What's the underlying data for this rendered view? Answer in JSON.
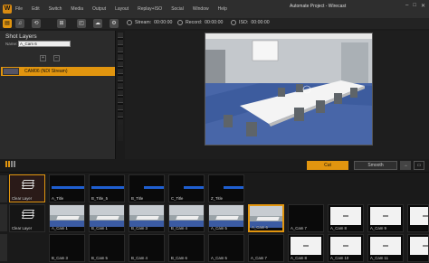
{
  "menubar": {
    "app_icon": "wirecast-logo",
    "items": [
      "File",
      "Edit",
      "Switch",
      "Media",
      "Output",
      "Layout",
      "Replay+ISO",
      "Social",
      "Window",
      "Help"
    ],
    "title": "Automate Project - Wirecast",
    "window_buttons": [
      "minimize",
      "maximize",
      "close"
    ]
  },
  "toolbar": {
    "icons": [
      "layers-icon",
      "audio-mixer-icon",
      "replay-icon",
      "transitions-icon",
      "add-icon",
      "cloud-icon",
      "tools-icon"
    ]
  },
  "status": {
    "stream_label": "Stream:",
    "stream_time": "00:00:00",
    "record_label": "Record:",
    "record_time": "00:00:00",
    "iso_label": "ISO:",
    "iso_time": "00:00:00"
  },
  "shot_layers": {
    "title": "Shot Layers",
    "name_label": "Name:",
    "name_value": "A_Cam 6",
    "add_label": "+",
    "remove_label": "−",
    "layer_name": "CAM06 (NDI Stream)"
  },
  "transition": {
    "cut_label": "Cut",
    "smooth_label": "Smooth",
    "go_label": "→"
  },
  "shots": {
    "row1": [
      "Clear Layer",
      "A_Title",
      "B_Title_5",
      "B_Title",
      "C_Title",
      "Z_Title"
    ],
    "row2": [
      "Clear Layer",
      "A_Cam 1",
      "B_Cam 1",
      "B_Cam 3",
      "B_Cam 4",
      "A_Cam 5",
      "A_Cam 6",
      "A_Cam 7",
      "A_Cam 8",
      "A_Cam 9"
    ],
    "row3": [
      "B_Cam 3",
      "B_Cam 5",
      "B_Cam 4",
      "B_Cam 6",
      "A_Cam 5",
      "A_Cam 7",
      "A_Cam 8",
      "A_Cam 10",
      "A_Cam 11"
    ]
  },
  "colors": {
    "accent": "#e1950f",
    "selection": "#e1950f",
    "title_bar_blue": "#1f5fd1"
  }
}
